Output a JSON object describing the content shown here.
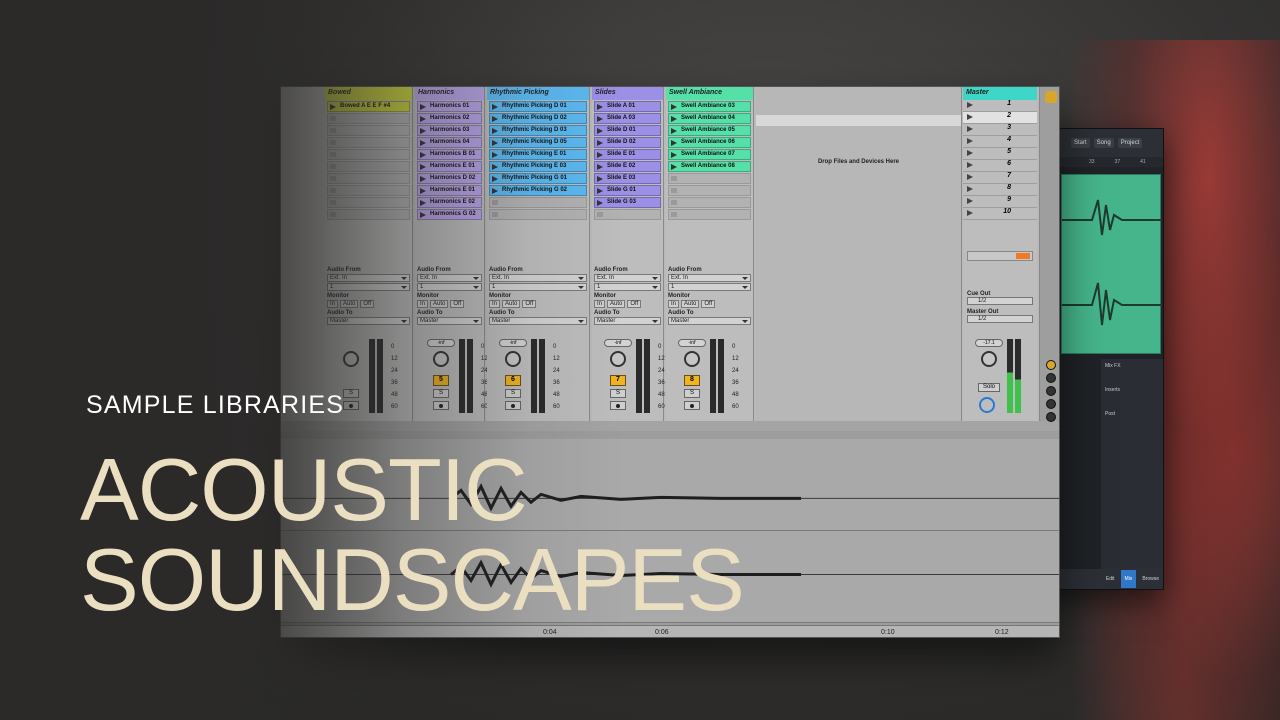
{
  "hero": {
    "kicker": "SAMPLE LIBRARIES",
    "title_line1": "ACOUSTIC",
    "title_line2": "SOUNDSCAPES"
  },
  "colors": {
    "title": "#ebdfc2",
    "kicker": "#ffffff",
    "background": "#2b2a29",
    "master_head": "#3ed6c6",
    "track_button": "#f0b323"
  },
  "daw": {
    "tracks": [
      {
        "name": "Bowed",
        "color": "#c9d23b",
        "clips": [
          "Bowed A E E F #4"
        ],
        "clip_color": "#c9d23b",
        "track_number": "",
        "volume": ""
      },
      {
        "name": "Harmonics",
        "color": "#b7a3e8",
        "clips": [
          "Harmonics 01",
          "Harmonics 02",
          "Harmonics 03",
          "Harmonics 04",
          "Harmonics B 01",
          "Harmonics E 01",
          "Harmonics D 02",
          "Harmonics E 01",
          "Harmonics E 02",
          "Harmonics G 02"
        ],
        "clip_color": "#b7a3e8",
        "track_number": "5",
        "volume": "-inf"
      },
      {
        "name": "Rhythmic Picking",
        "color": "#5bb8f0",
        "clips": [
          "Rhythmic Picking D 01",
          "Rhythmic Picking D 02",
          "Rhythmic Picking D 03",
          "Rhythmic Picking D 05",
          "Rhythmic Picking E 01",
          "Rhythmic Picking E 03",
          "Rhythmic Picking G 01",
          "Rhythmic Picking G 02"
        ],
        "clip_color": "#5bb8f0",
        "track_number": "6",
        "volume": "-inf"
      },
      {
        "name": "Slides",
        "color": "#9b8fe6",
        "clips": [
          "Slide A 01",
          "Slide A 03",
          "Slide D 01",
          "Slide D 02",
          "Slide E 01",
          "Slide E 02",
          "Slide E 03",
          "Slide G 01",
          "Slide G 03"
        ],
        "clip_color": "#9b8fe6",
        "track_number": "7",
        "volume": "-inf"
      },
      {
        "name": "Swell Ambiance",
        "color": "#55e0a8",
        "clips": [
          "Swell Ambiance 03",
          "Swell Ambiance 04",
          "Swell Ambiance 05",
          "Swell Ambiance 06",
          "Swell Ambiance 07",
          "Swell Ambiance 08"
        ],
        "clip_color": "#55e0a8",
        "track_number": "8",
        "volume": "-inf"
      }
    ],
    "io": {
      "audio_from": "Audio From",
      "ext_in": "Ext. In",
      "channel": "1",
      "monitor": "Monitor",
      "in": "In",
      "auto": "Auto",
      "off": "Off",
      "audio_to": "Audio To",
      "master": "Master",
      "solo_s": "S"
    },
    "db_scale": [
      "0",
      "12",
      "24",
      "36",
      "48",
      "60"
    ],
    "drop_text": "Drop Files and Devices Here",
    "master": {
      "name": "Master",
      "scenes": [
        "1",
        "2",
        "3",
        "4",
        "5",
        "6",
        "7",
        "8",
        "9",
        "10"
      ],
      "cue_out_label": "Cue Out",
      "cue_out_value": "1/2",
      "master_out_label": "Master Out",
      "master_out_value": "1/2",
      "volume": "-17.1",
      "solo": "Solo"
    },
    "timeline": [
      "0:04",
      "0:06",
      "0:10",
      "0:12"
    ]
  },
  "daw2": {
    "topbar": [
      "Start",
      "Song",
      "Project"
    ],
    "ruler": [
      "33",
      "37",
      "41"
    ],
    "mixer": [
      "Mix FX",
      "Inserts",
      "Post"
    ],
    "bottombar": [
      "Edit",
      "Mix",
      "Browse"
    ],
    "active_tab": "Mix"
  }
}
